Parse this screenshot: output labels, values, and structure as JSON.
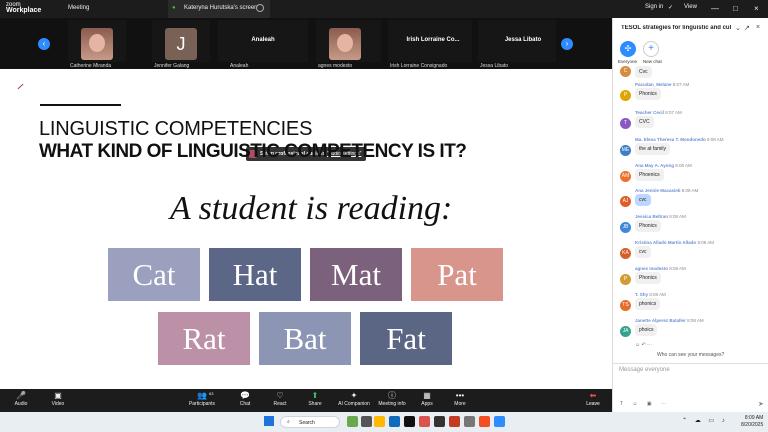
{
  "topbar": {
    "zoom": "zoom",
    "workplace": "Workplace",
    "meeting": "Meeting",
    "tab_title": "Kateryna Hurutska's screen",
    "signin": "Sign in",
    "view": "View"
  },
  "participants": [
    {
      "label": "Catherine Miranda",
      "type": "photo"
    },
    {
      "label": "Jennifer Galang",
      "type": "initial",
      "initial": "J"
    },
    {
      "label": "Analeah",
      "type": "name",
      "bigname": "Analeah"
    },
    {
      "label": "agnes modesto",
      "type": "photo"
    },
    {
      "label": "Irish Lorraine Consignado",
      "type": "name",
      "bigname": "Irish Lorraine Co..."
    },
    {
      "label": "Jessa Libato",
      "type": "name",
      "bigname": "Jessa Libato"
    }
  ],
  "slide": {
    "popup": {
      "prefix": "Setup professional audio in ",
      "link": "\"audio settings\""
    },
    "heading1": "LINGUISTIC COMPETENCIES",
    "heading2": "WHAT KIND OF LINGUISTIC COMPETENCY IS IT?",
    "sentence": "A student is reading:",
    "words": [
      {
        "text": "Cat",
        "color": "#9aa0bd"
      },
      {
        "text": "Hat",
        "color": "#5c6686"
      },
      {
        "text": "Mat",
        "color": "#7b617c"
      },
      {
        "text": "Pat",
        "color": "#d8958b"
      },
      {
        "text": "Rat",
        "color": "#bc91a8"
      },
      {
        "text": "Bat",
        "color": "#8c95b4"
      },
      {
        "text": "Fat",
        "color": "#5b6684"
      }
    ]
  },
  "toolbar": {
    "audio": "Audio",
    "video": "Video",
    "participants": "Participants",
    "participants_count": "63",
    "chat": "Chat",
    "react": "React",
    "share": "Share",
    "ai": "AI Companion",
    "meeting_info": "Meeting info",
    "apps": "Apps",
    "more": "More",
    "leave": "Leave"
  },
  "chat": {
    "title": "TESOL strategies for linguistic and cultural...",
    "everyone": "Everyone",
    "new_chat": "New chat",
    "messages": [
      {
        "name": "",
        "time": "",
        "text": "Cvc",
        "avatar": "C",
        "color": "#d88a3d"
      },
      {
        "name": "Pacudan_Melane",
        "time": "8:07 AM",
        "text": "Phonics",
        "avatar": "P",
        "color": "#e0a400"
      },
      {
        "name": "Teacher Cecil",
        "time": "8:07 AM",
        "text": "CVC",
        "avatar": "T",
        "color": "#8b58c2"
      },
      {
        "name": "Ma. Elena Theresa T. Mondonedo",
        "time": "8:08 AM",
        "text": "the at family",
        "avatar": "ME",
        "color": "#3d7ec5"
      },
      {
        "name": "Ana May A. Ayong",
        "time": "8:08 AM",
        "text": "Phoenics",
        "avatar": "AM",
        "color": "#ef6f2c"
      },
      {
        "name": "Ana Jennie Macasieb",
        "time": "8:08 AM",
        "text": "cvc",
        "avatar": "AJ",
        "color": "#de5d27",
        "selected": true
      },
      {
        "name": "Jessica Beltran",
        "time": "8:08 AM",
        "text": "Phonics",
        "avatar": "JB",
        "color": "#3e88d8"
      },
      {
        "name": "Kristina Allado Martin Allado",
        "time": "8:08 AM",
        "text": "cvc",
        "avatar": "KA",
        "color": "#d45f29"
      },
      {
        "name": "agnes modesto",
        "time": "8:08 AM",
        "text": "Phonics",
        "avatar": "P",
        "color": "#d39b33"
      },
      {
        "name": "T. Shy",
        "time": "8:08 AM",
        "text": "phonics",
        "avatar": "TS",
        "color": "#e36e2a"
      },
      {
        "name": "Janette Alperez Bataller",
        "time": "8:08 AM",
        "text": "phoics",
        "avatar": "JA",
        "color": "#35a38b"
      }
    ],
    "who": "Who can see your messages?",
    "input_placeholder": "Message everyone"
  },
  "taskbar": {
    "search": "Search",
    "time": "8:09 AM",
    "date": "8/20/2025"
  }
}
